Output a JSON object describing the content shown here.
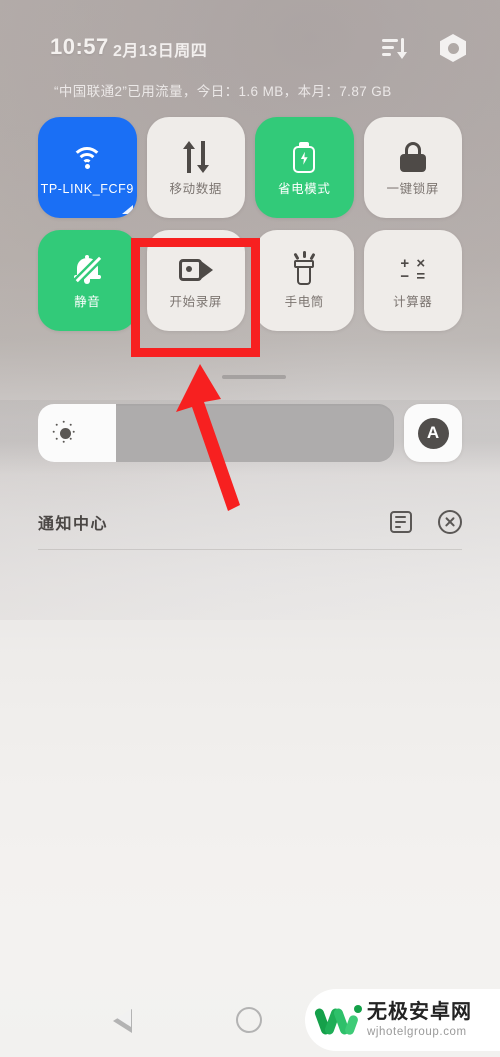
{
  "status_bar": {
    "time": "10:57",
    "date": "2月13日周四",
    "data_usage": "“中国联通2”已用流量，今日：1.6 MB，本月：7.87 GB",
    "sort_icon": "sort-descending-icon",
    "settings_icon": "hex-gear-icon"
  },
  "quick_settings": {
    "rows": [
      [
        {
          "label": "TP-LINK_FCF9",
          "icon": "wifi-icon",
          "state": "on",
          "accent": "#1a6ff5"
        },
        {
          "label": "移动数据",
          "icon": "mobile-data-icon",
          "state": "off"
        },
        {
          "label": "省电模式",
          "icon": "battery-saver-icon",
          "state": "on",
          "accent": "#32ca79"
        },
        {
          "label": "一键锁屏",
          "icon": "lock-icon",
          "state": "off"
        }
      ],
      [
        {
          "label": "静音",
          "icon": "bell-off-icon",
          "state": "on",
          "accent": "#32ca79"
        },
        {
          "label": "开始录屏",
          "icon": "screen-record-icon",
          "state": "off",
          "highlighted": true
        },
        {
          "label": "手电筒",
          "icon": "flashlight-icon",
          "state": "off"
        },
        {
          "label": "计算器",
          "icon": "calculator-icon",
          "state": "off"
        }
      ]
    ],
    "calculator_glyphs": [
      "+",
      "×",
      "−",
      "="
    ]
  },
  "brightness": {
    "slider_icon": "sun-icon",
    "level_percent": 22,
    "auto_label": "A",
    "auto_icon": "auto-brightness-icon"
  },
  "notification_center": {
    "title": "通知中心",
    "settings_icon": "notification-settings-icon",
    "clear_icon": "clear-all-icon"
  },
  "annotation": {
    "highlight_color": "#f72020",
    "arrow_color": "#f72020",
    "target_tile": "开始录屏"
  },
  "nav_bar": {
    "back_icon": "back-triangle-icon",
    "home_icon": "home-circle-icon"
  },
  "watermark": {
    "site_name": "无极安卓网",
    "url": "wjhotelgroup.com",
    "logo_icon": "w-logo-icon"
  }
}
